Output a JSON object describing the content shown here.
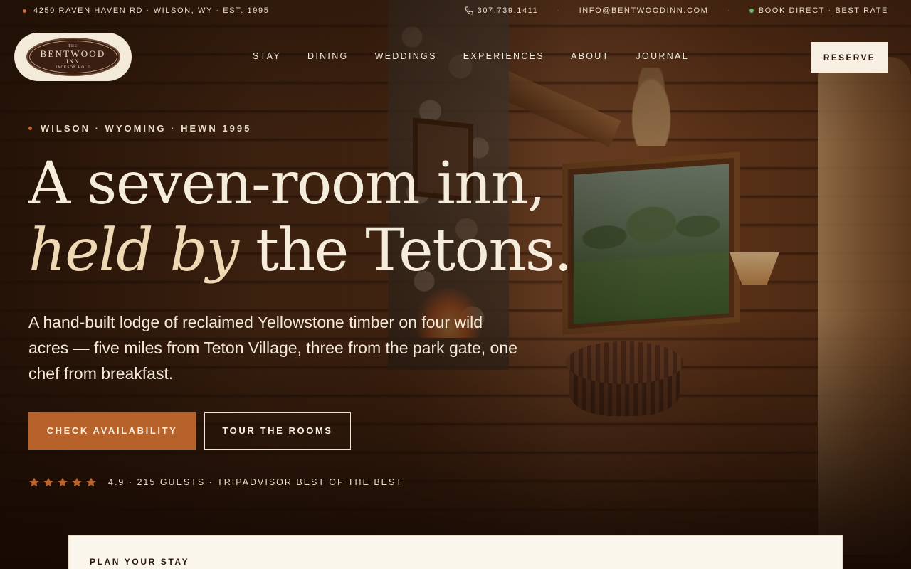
{
  "topbar": {
    "address": "4250 RAVEN HAVEN RD · WILSON, WY · EST. 1995",
    "phone": "307.739.1411",
    "email": "INFO@BENTWOODINN.COM",
    "book_direct": "BOOK DIRECT · BEST RATE"
  },
  "logo": {
    "the": "THE",
    "name": "BENTWOOD",
    "inn": "INN",
    "location": "JACKSON HOLE"
  },
  "nav": {
    "items": [
      "STAY",
      "DINING",
      "WEDDINGS",
      "EXPERIENCES",
      "ABOUT",
      "JOURNAL"
    ],
    "reserve": "RESERVE"
  },
  "hero": {
    "eyebrow": "WILSON · WYOMING · HEWN 1995",
    "headline_line1": "A seven-room inn,",
    "headline_italic": "held by",
    "headline_rest": " the Tetons.",
    "lede": "A hand-built lodge of reclaimed Yellowstone timber on four wild acres — five miles from Teton Village, three from the park gate, one chef from breakfast.",
    "cta_primary": "CHECK AVAILABILITY",
    "cta_secondary": "TOUR THE ROOMS",
    "rating": {
      "stars": 5,
      "text": "4.9 · 215 GUESTS · TRIPADVISOR BEST OF THE BEST"
    }
  },
  "booking": {
    "title": "PLAN YOUR STAY"
  },
  "colors": {
    "accent": "#b8622b",
    "cream": "#f4ead9",
    "dark_brown": "#2a160b",
    "status_green": "#5fbf6a"
  },
  "icons": [
    "phone-icon",
    "star-icon",
    "status-dot-icon"
  ]
}
